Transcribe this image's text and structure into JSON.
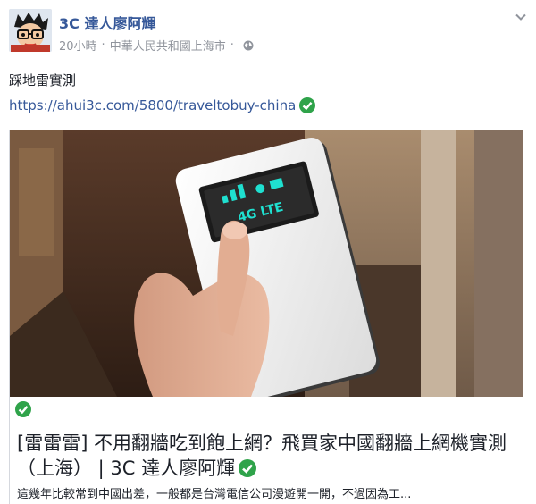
{
  "post": {
    "author": "3C 達人廖阿輝",
    "time": "20小時",
    "separator": "·",
    "location": "中華人民共和國上海市",
    "privacy_icon": "globe-icon",
    "text": "踩地雷實測",
    "link": "https://ahui3c.com/5800/traveltobuy-china"
  },
  "card": {
    "title": "[雷雷雷] 不用翻牆吃到飽上網？飛買家中國翻牆上網機實測（上海） | 3C 達人廖阿輝",
    "description": "這幾年比較常到中國出差，一般都是台灣電信公司漫遊開一開，不過因為工...",
    "device_screen_label": "4G LTE"
  },
  "colors": {
    "link": "#365899",
    "meta": "#90949c",
    "verified": "#2fa34a"
  }
}
